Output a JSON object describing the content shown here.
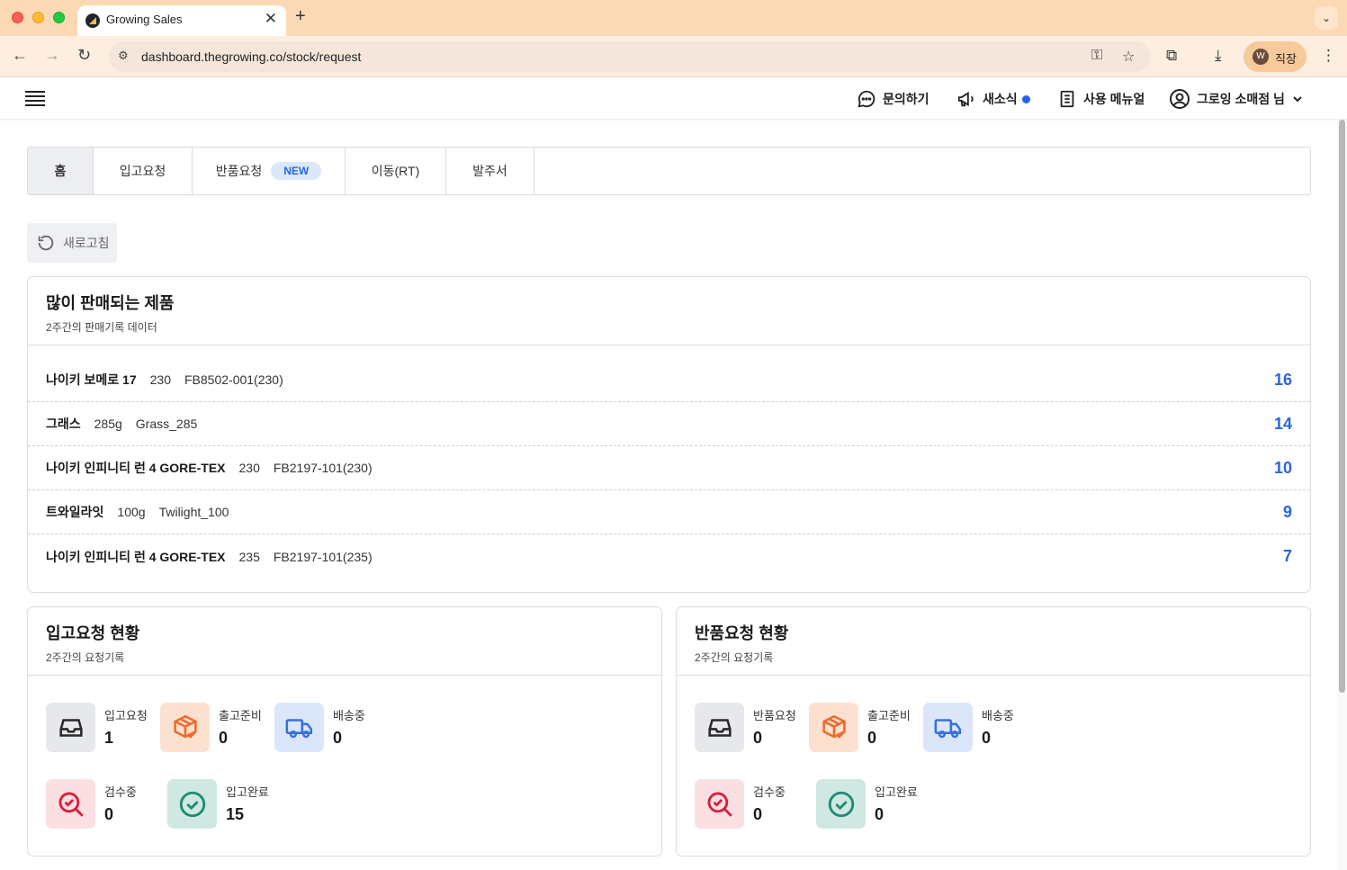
{
  "browser": {
    "tab_title": "Growing Sales",
    "url": "dashboard.thegrowing.co/stock/request",
    "profile_initial": "W",
    "profile_label": "직장"
  },
  "header": {
    "inquiry": "문의하기",
    "news": "새소식",
    "manual": "사용 메뉴얼",
    "user": "그로잉 소매점 님"
  },
  "tabs": [
    {
      "label": "홈"
    },
    {
      "label": "입고요청"
    },
    {
      "label": "반품요청",
      "badge": "NEW"
    },
    {
      "label": "이동(RT)"
    },
    {
      "label": "발주서"
    }
  ],
  "refresh_label": "새로고침",
  "best_sellers": {
    "title": "많이 판매되는 제품",
    "subtitle": "2주간의 판매기록 데이터",
    "items": [
      {
        "name": "나이키 보메로 17",
        "option": "230",
        "code": "FB8502-001(230)",
        "count": "16"
      },
      {
        "name": "그래스",
        "option": "285g",
        "code": "Grass_285",
        "count": "14"
      },
      {
        "name": "나이키 인피니티 런 4 GORE-TEX",
        "option": "230",
        "code": "FB2197-101(230)",
        "count": "10"
      },
      {
        "name": "트와일라잇",
        "option": "100g",
        "code": "Twilight_100",
        "count": "9"
      },
      {
        "name": "나이키 인피니티 런 4 GORE-TEX",
        "option": "235",
        "code": "FB2197-101(235)",
        "count": "7"
      }
    ]
  },
  "inbound": {
    "title": "입고요청 현황",
    "subtitle": "2주간의 요청기록",
    "stats": [
      {
        "label": "입고요청",
        "value": "1"
      },
      {
        "label": "출고준비",
        "value": "0"
      },
      {
        "label": "배송중",
        "value": "0"
      },
      {
        "label": "검수중",
        "value": "0"
      },
      {
        "label": "입고완료",
        "value": "15"
      }
    ]
  },
  "returns": {
    "title": "반품요청 현황",
    "subtitle": "2주간의 요청기록",
    "stats": [
      {
        "label": "반품요청",
        "value": "0"
      },
      {
        "label": "출고준비",
        "value": "0"
      },
      {
        "label": "배송중",
        "value": "0"
      },
      {
        "label": "검수중",
        "value": "0"
      },
      {
        "label": "입고완료",
        "value": "0"
      }
    ]
  },
  "colors": {
    "accent_blue": "#2b66d9",
    "orange_icon": "#f06a28",
    "red_icon": "#d81e3c",
    "teal_icon": "#1f8a74"
  }
}
